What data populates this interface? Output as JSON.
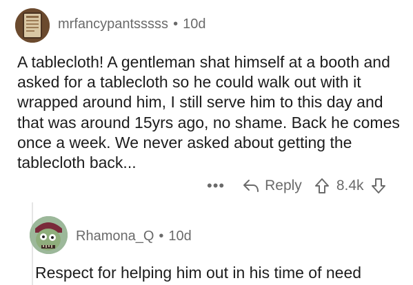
{
  "comment": {
    "username": "mrfancypantsssss",
    "separator": "•",
    "age": "10d",
    "body": "A tablecloth! A gentleman shat himself at a booth and asked for a tablecloth so he could walk out with it wrapped around him, I still serve him to this day and that was around 15yrs ago, no shame. Back he comes once a week. We never asked about getting the tablecloth back...",
    "actions": {
      "more": "•••",
      "reply": "Reply",
      "score": "8.4k"
    }
  },
  "reply": {
    "username": "Rhamona_Q",
    "separator": "•",
    "age": "10d",
    "body": "Respect for helping him out in his time of need"
  },
  "colors": {
    "meta": "#6a6a6a",
    "text": "#1c1c1c",
    "thread_line": "#e5e5e5"
  }
}
